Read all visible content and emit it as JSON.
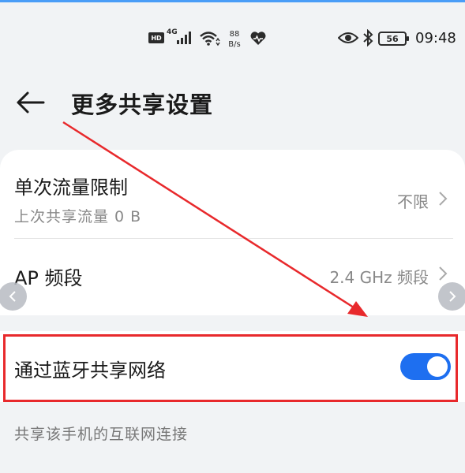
{
  "status_bar": {
    "hd": "HD",
    "network": "4G",
    "speed_value": "88",
    "speed_unit": "B/s",
    "battery": "56",
    "time": "09:48"
  },
  "header": {
    "title": "更多共享设置"
  },
  "settings": {
    "traffic_limit": {
      "title": "单次流量限制",
      "subtitle": "上次共享流量 0 B",
      "value": "不限"
    },
    "ap_band": {
      "title": "AP 频段",
      "value": "2.4 GHz 频段"
    },
    "bluetooth_share": {
      "title": "通过蓝牙共享网络",
      "enabled": true
    }
  },
  "footer": {
    "note": "共享该手机的互联网连接"
  },
  "icons": {
    "back": "back-arrow-icon",
    "chevron": "chevron-right-icon",
    "nav_prev": "chevron-left-icon",
    "nav_next": "chevron-right-icon"
  },
  "colors": {
    "accent": "#1e6ff0",
    "annotation": "#e8292c",
    "background": "#f1f3f5"
  }
}
